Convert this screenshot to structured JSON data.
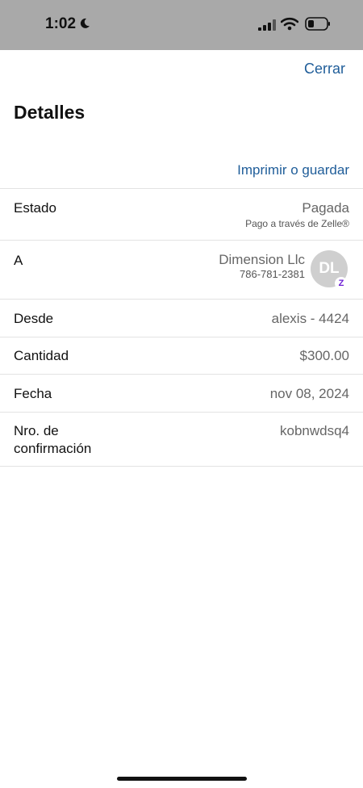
{
  "status_bar": {
    "time": "1:02"
  },
  "header": {
    "close_label": "Cerrar",
    "title": "Detalles",
    "print_label": "Imprimir o guardar"
  },
  "details": {
    "status": {
      "label": "Estado",
      "value": "Pagada",
      "sub": "Pago a través de Zelle®"
    },
    "to": {
      "label": "A",
      "name": "Dimension Llc",
      "phone": "786-781-2381",
      "initials": "DL",
      "badge": "Z"
    },
    "from": {
      "label": "Desde",
      "value": "alexis - 4424"
    },
    "amount": {
      "label": "Cantidad",
      "value": "$300.00"
    },
    "date": {
      "label": "Fecha",
      "value": "nov 08, 2024"
    },
    "confirmation": {
      "label_line1": "Nro. de",
      "label_line2": "confirmación",
      "value": "kobnwdsq4"
    }
  },
  "colors": {
    "link": "#1f5d99",
    "zelle": "#6d1ed4"
  }
}
